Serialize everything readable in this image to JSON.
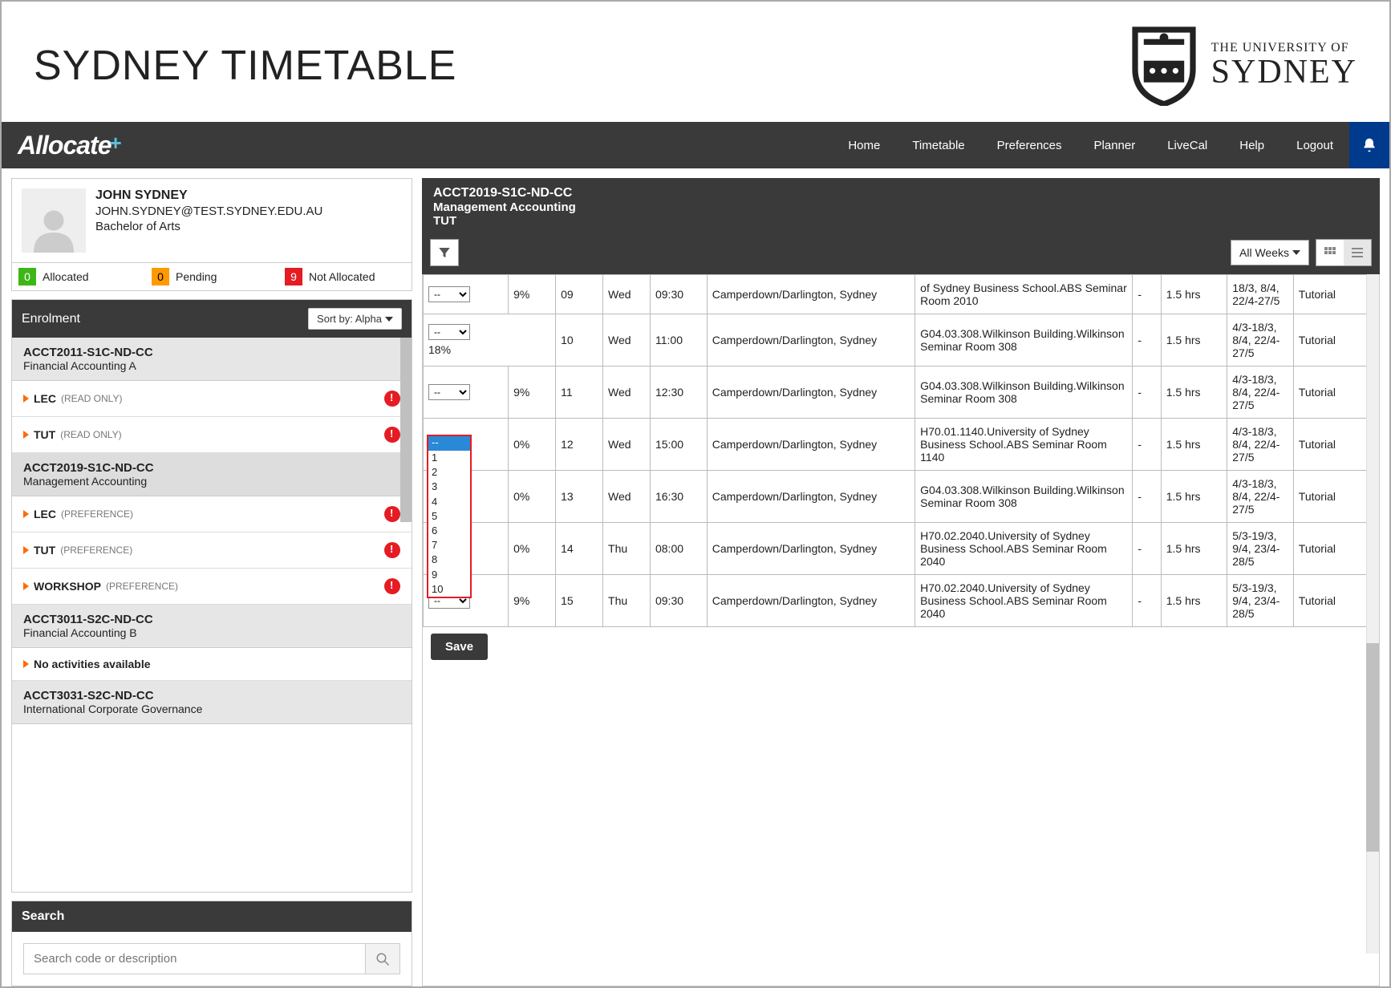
{
  "branding": {
    "app_title": "SYDNEY TIMETABLE",
    "uni_small": "THE UNIVERSITY OF",
    "uni_big": "SYDNEY",
    "app_logo": "Allocate",
    "app_logo_plus": "+"
  },
  "nav": {
    "items": [
      "Home",
      "Timetable",
      "Preferences",
      "Planner",
      "LiveCal",
      "Help",
      "Logout"
    ]
  },
  "user": {
    "name": "JOHN SYDNEY",
    "email": "JOHN.SYDNEY@TEST.SYDNEY.EDU.AU",
    "degree": "Bachelor of Arts",
    "status": {
      "allocated_n": "0",
      "allocated_l": "Allocated",
      "pending_n": "0",
      "pending_l": "Pending",
      "notalloc_n": "9",
      "notalloc_l": "Not Allocated"
    }
  },
  "enrolment": {
    "title": "Enrolment",
    "sort_label": "Sort by: Alpha",
    "courses": [
      {
        "code": "ACCT2011-S1C-ND-CC",
        "name": "Financial Accounting A",
        "acts": [
          {
            "type": "LEC",
            "note": "(READ ONLY)",
            "warn": true
          },
          {
            "type": "TUT",
            "note": "(READ ONLY)",
            "warn": true
          }
        ]
      },
      {
        "code": "ACCT2019-S1C-ND-CC",
        "name": "Management Accounting",
        "active": true,
        "acts": [
          {
            "type": "LEC",
            "note": "(PREFERENCE)",
            "warn": true
          },
          {
            "type": "TUT",
            "note": "(PREFERENCE)",
            "warn": true
          },
          {
            "type": "WORKSHOP",
            "note": "(PREFERENCE)",
            "warn": true
          }
        ]
      },
      {
        "code": "ACCT3011-S2C-ND-CC",
        "name": "Financial Accounting B",
        "acts": [
          {
            "type": "No activities available",
            "note": "",
            "warn": false
          }
        ]
      },
      {
        "code": "ACCT3031-S2C-ND-CC",
        "name": "International Corporate Governance",
        "acts": []
      }
    ]
  },
  "search": {
    "title": "Search",
    "placeholder": "Search code or description"
  },
  "subject": {
    "code": "ACCT2019-S1C-ND-CC",
    "name": "Management Accounting",
    "type": "TUT",
    "weeks_label": "All Weeks"
  },
  "dropdown_options": [
    "--",
    "1",
    "2",
    "3",
    "4",
    "5",
    "6",
    "7",
    "8",
    "9",
    "10"
  ],
  "rows": [
    {
      "sel": "--",
      "pct": "9%",
      "act": "09",
      "day": "Wed",
      "time": "09:30",
      "campus": "Camperdown/Darlington, Sydney",
      "loc": "of Sydney Business School.ABS Seminar Room 2010",
      "extra": "-",
      "dur": "1.5 hrs",
      "weeks": "18/3, 8/4, 22/4-27/5",
      "desc": "Tutorial"
    },
    {
      "sel": "--",
      "pct": "18%",
      "act": "10",
      "day": "Wed",
      "time": "11:00",
      "campus": "Camperdown/Darlington, Sydney",
      "loc": "G04.03.308.Wilkinson Building.Wilkinson Seminar Room 308",
      "extra": "-",
      "dur": "1.5 hrs",
      "weeks": "4/3-18/3, 8/4, 22/4-27/5",
      "desc": "Tutorial",
      "stacked": true
    },
    {
      "sel": "--",
      "pct": "9%",
      "act": "11",
      "day": "Wed",
      "time": "12:30",
      "campus": "Camperdown/Darlington, Sydney",
      "loc": "G04.03.308.Wilkinson Building.Wilkinson Seminar Room 308",
      "extra": "-",
      "dur": "1.5 hrs",
      "weeks": "4/3-18/3, 8/4, 22/4-27/5",
      "desc": "Tutorial"
    },
    {
      "sel": "--",
      "pct": "0%",
      "act": "12",
      "day": "Wed",
      "time": "15:00",
      "campus": "Camperdown/Darlington, Sydney",
      "loc": "H70.01.1140.University of Sydney Business School.ABS Seminar Room 1140",
      "extra": "-",
      "dur": "1.5 hrs",
      "weeks": "4/3-18/3, 8/4, 22/4-27/5",
      "desc": "Tutorial",
      "open": true
    },
    {
      "sel": "",
      "pct": "0%",
      "act": "13",
      "day": "Wed",
      "time": "16:30",
      "campus": "Camperdown/Darlington, Sydney",
      "loc": "G04.03.308.Wilkinson Building.Wilkinson Seminar Room 308",
      "extra": "-",
      "dur": "1.5 hrs",
      "weeks": "4/3-18/3, 8/4, 22/4-27/5",
      "desc": "Tutorial"
    },
    {
      "sel": "",
      "pct": "0%",
      "act": "14",
      "day": "Thu",
      "time": "08:00",
      "campus": "Camperdown/Darlington, Sydney",
      "loc": "H70.02.2040.University of Sydney Business School.ABS Seminar Room 2040",
      "extra": "-",
      "dur": "1.5 hrs",
      "weeks": "5/3-19/3, 9/4, 23/4-28/5",
      "desc": "Tutorial"
    },
    {
      "sel": "--",
      "pct": "9%",
      "act": "15",
      "day": "Thu",
      "time": "09:30",
      "campus": "Camperdown/Darlington, Sydney",
      "loc": "H70.02.2040.University of Sydney Business School.ABS Seminar Room 2040",
      "extra": "-",
      "dur": "1.5 hrs",
      "weeks": "5/3-19/3, 9/4, 23/4-28/5",
      "desc": "Tutorial"
    }
  ],
  "save_label": "Save"
}
